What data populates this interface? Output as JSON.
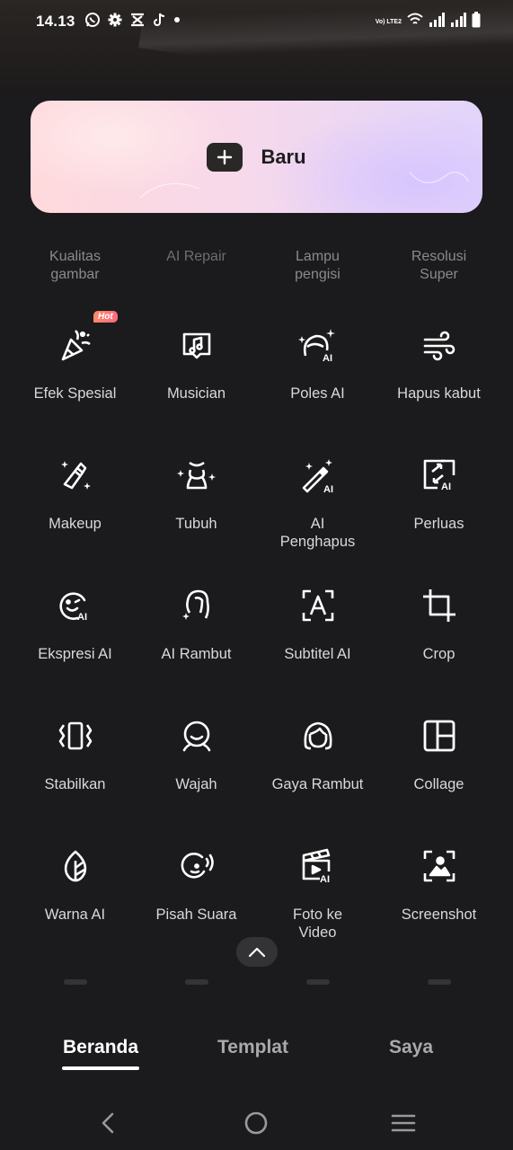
{
  "status_bar": {
    "time": "14.13",
    "network_label": "Vo) LTE2",
    "left_icons": [
      "whatsapp-icon",
      "gear-icon",
      "capcut-icon",
      "tiktok-icon",
      "notification-dot"
    ],
    "right_icons": [
      "volte-icon",
      "wifi-icon",
      "signal-1-icon",
      "signal-2-icon",
      "battery-icon"
    ]
  },
  "new_button": {
    "label": "Baru",
    "icon": "plus-icon"
  },
  "faded_tools": [
    {
      "line1": "Kualitas",
      "line2": "gambar"
    },
    {
      "line1": "AI Repair",
      "line2": ""
    },
    {
      "line1": "Lampu",
      "line2": "pengisi"
    },
    {
      "line1": "Resolusi",
      "line2": "Super"
    }
  ],
  "hot_badge": "Hot",
  "tools": [
    {
      "label": "Efek Spesial",
      "icon": "party-popper-icon"
    },
    {
      "label": "Musician",
      "icon": "music-screen-icon"
    },
    {
      "label": "Poles AI",
      "icon": "face-sparkle-ai-icon"
    },
    {
      "label": "Hapus kabut",
      "icon": "wind-icon"
    },
    {
      "label": "Makeup",
      "icon": "lipstick-icon"
    },
    {
      "label": "Tubuh",
      "icon": "body-icon"
    },
    {
      "label": "AI Penghapus",
      "icon": "magic-wand-ai-icon"
    },
    {
      "label": "Perluas",
      "icon": "expand-ai-icon"
    },
    {
      "label": "Ekspresi AI",
      "icon": "smile-ai-icon"
    },
    {
      "label": "AI Rambut",
      "icon": "hair-sparkle-icon"
    },
    {
      "label": "Subtitel AI",
      "icon": "text-frame-icon"
    },
    {
      "label": "Crop",
      "icon": "crop-icon"
    },
    {
      "label": "Stabilkan",
      "icon": "stabilize-icon"
    },
    {
      "label": "Wajah",
      "icon": "face-icon"
    },
    {
      "label": "Gaya Rambut",
      "icon": "hairstyle-icon"
    },
    {
      "label": "Collage",
      "icon": "collage-icon"
    },
    {
      "label": "Warna AI",
      "icon": "leaf-color-icon"
    },
    {
      "label": "Pisah Suara",
      "icon": "voice-split-icon"
    },
    {
      "label": "Foto ke Video",
      "icon": "clapper-ai-icon"
    },
    {
      "label": "Screenshot",
      "icon": "screenshot-icon"
    }
  ],
  "tabs": [
    {
      "label": "Beranda",
      "active": true
    },
    {
      "label": "Templat",
      "active": false
    },
    {
      "label": "Saya",
      "active": false
    }
  ],
  "nav": [
    "back-icon",
    "home-icon",
    "recents-icon"
  ],
  "colors": {
    "background": "#1b1a1c",
    "card_pink": "#ffd9dc",
    "card_lavender": "#e2d5fb",
    "hot_badge": "#ff7a72"
  }
}
